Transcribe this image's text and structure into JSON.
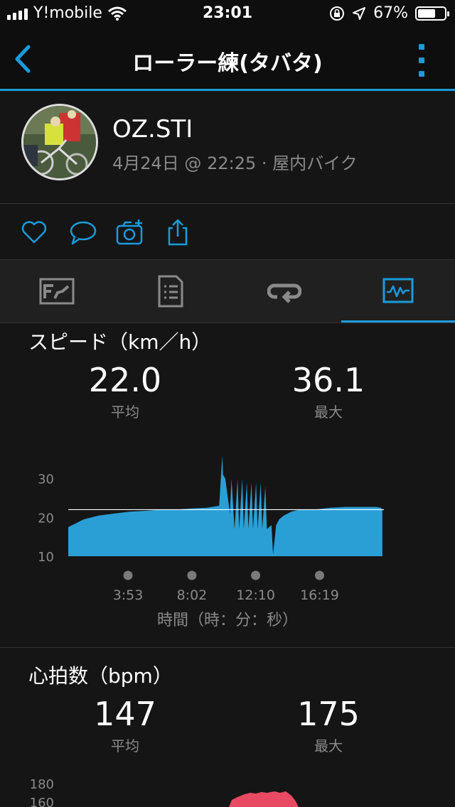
{
  "status_bar": {
    "carrier": "Y!mobile",
    "time": "23:01",
    "battery": "67%",
    "battery_level": 0.67
  },
  "nav": {
    "title": "ローラー練(タバタ)"
  },
  "profile": {
    "name": "OZ.STI",
    "meta": "4月24日 @ 22:25 · 屋内バイク"
  },
  "actions": [
    "heart-icon",
    "comment-icon",
    "add-photo-icon",
    "share-icon"
  ],
  "tabs": [
    {
      "icon": "overview-icon",
      "active": false
    },
    {
      "icon": "details-icon",
      "active": false
    },
    {
      "icon": "laps-icon",
      "active": false
    },
    {
      "icon": "charts-icon",
      "active": true
    }
  ],
  "speed": {
    "title": "スピード（km／h）",
    "avg_value": "22.0",
    "avg_label": "平均",
    "max_value": "36.1",
    "max_label": "最大"
  },
  "heart_rate": {
    "title": "心拍数（bpm）",
    "avg_value": "147",
    "avg_label": "平均",
    "max_value": "175",
    "max_label": "最大"
  },
  "chart_data": [
    {
      "type": "area",
      "title": "スピード（km／h）",
      "xlabel": "時間（時：分：秒）",
      "ylabel": "",
      "yticks": [
        "30",
        "20",
        "10"
      ],
      "ylim": [
        10,
        38
      ],
      "xlim": [
        0,
        20.5
      ],
      "xticks": [
        {
          "value": 3.88,
          "label": "3:53"
        },
        {
          "value": 8.03,
          "label": "8:02"
        },
        {
          "value": 12.17,
          "label": "12:10"
        },
        {
          "value": 16.32,
          "label": "16:19"
        }
      ],
      "reference_line": 22.0,
      "color": "#2a9fd6",
      "x": [
        0,
        0.5,
        1.0,
        1.5,
        2.0,
        3.0,
        4.0,
        5.0,
        6.0,
        7.0,
        8.0,
        9.0,
        9.8,
        10.0,
        10.05,
        10.2,
        10.5,
        10.6,
        10.8,
        11.0,
        11.1,
        11.3,
        11.4,
        11.6,
        11.7,
        11.9,
        12.0,
        12.2,
        12.3,
        12.5,
        12.6,
        12.8,
        12.9,
        13.2,
        13.3,
        13.5,
        13.7,
        14.0,
        14.5,
        15.0,
        16.0,
        17.0,
        18.0,
        19.0,
        20.0,
        20.3,
        20.4
      ],
      "values": [
        17.5,
        18.5,
        19.5,
        20.0,
        20.5,
        21.0,
        21.5,
        21.7,
        22.0,
        22.0,
        22.3,
        22.5,
        23.0,
        36.0,
        31.0,
        30.0,
        21.0,
        30.0,
        17.0,
        30.0,
        17.0,
        30.0,
        17.0,
        29.0,
        17.0,
        29.0,
        17.0,
        29.0,
        17.0,
        29.0,
        17.0,
        28.0,
        17.0,
        18.0,
        10.5,
        18.0,
        19.5,
        20.5,
        21.5,
        22.0,
        22.0,
        22.5,
        22.7,
        22.7,
        22.7,
        22.5,
        22.0
      ]
    },
    {
      "type": "area",
      "title": "心拍数（bpm）",
      "yticks": [
        "180",
        "160"
      ],
      "color": "#e84a63"
    }
  ]
}
